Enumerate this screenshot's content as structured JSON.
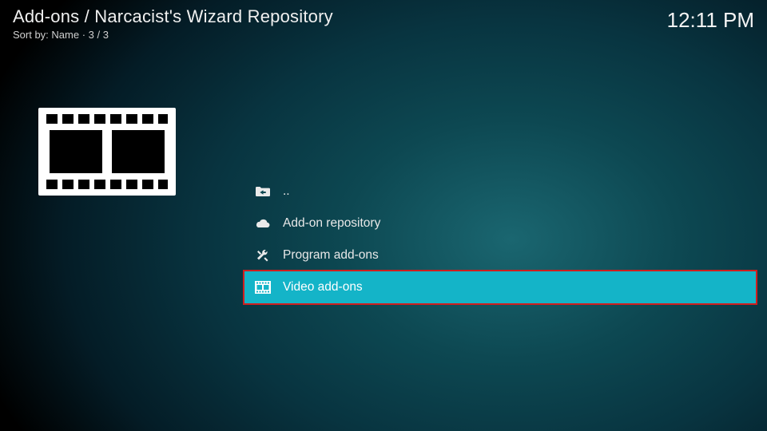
{
  "header": {
    "breadcrumb": "Add-ons / Narcacist's Wizard Repository",
    "sort_prefix": "Sort by: ",
    "sort_field": "Name",
    "count_sep": "  ·  ",
    "count": "3 / 3",
    "clock": "12:11 PM"
  },
  "list": {
    "items": [
      {
        "icon": "folder-back",
        "label": ".."
      },
      {
        "icon": "cloud",
        "label": "Add-on repository"
      },
      {
        "icon": "tools",
        "label": "Program add-ons"
      },
      {
        "icon": "film",
        "label": "Video add-ons"
      }
    ],
    "selected_index": 3
  }
}
